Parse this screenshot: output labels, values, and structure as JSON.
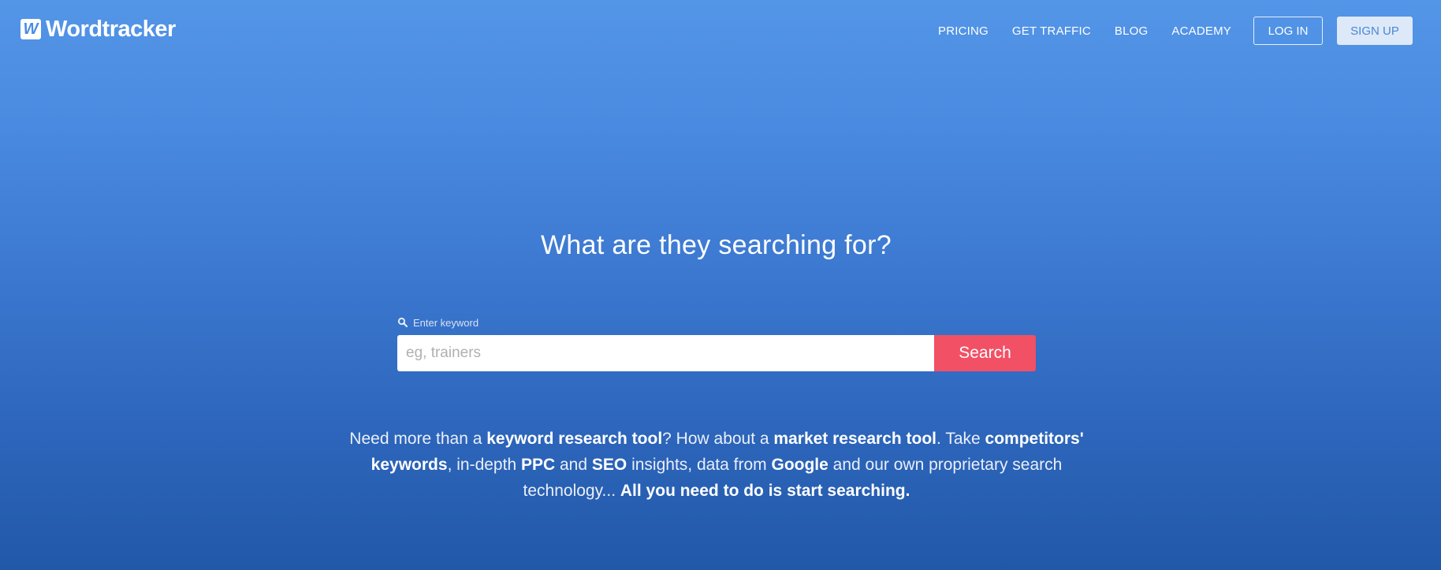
{
  "brand": {
    "logo_mark": "W",
    "name": "Wordtracker"
  },
  "nav": {
    "items": [
      {
        "label": "PRICING"
      },
      {
        "label": "GET TRAFFIC"
      },
      {
        "label": "BLOG"
      },
      {
        "label": "ACADEMY"
      }
    ],
    "login_label": "LOG IN",
    "signup_label": "SIGN UP"
  },
  "hero": {
    "title": "What are they searching for?"
  },
  "search": {
    "icon": "search-icon",
    "label": "Enter keyword",
    "placeholder": "eg, trainers",
    "value": "",
    "button_label": "Search"
  },
  "blurb": {
    "t1": "Need more than a ",
    "b1": "keyword research tool",
    "t2": "? How about a ",
    "b2": "market research tool",
    "t3": ". Take ",
    "b3": "competitors' keywords",
    "t4": ", in-depth ",
    "b4": "PPC",
    "t5": " and ",
    "b5": "SEO",
    "t6": " insights, data from ",
    "b6": "Google",
    "t7": " and our own proprietary search technology... ",
    "b7": "All you need to do is start searching."
  },
  "colors": {
    "background_top": "#5395e7",
    "background_bottom": "#2258a8",
    "search_button": "#f25065",
    "signup_button": "#dde9f8"
  }
}
